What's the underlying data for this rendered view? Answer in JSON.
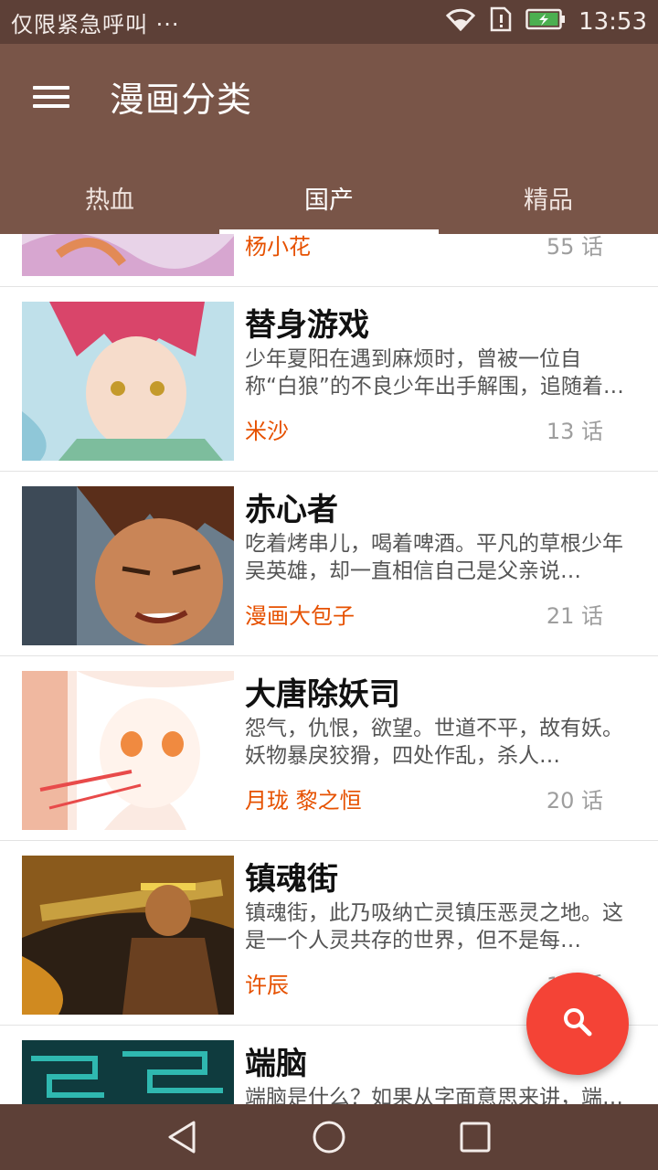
{
  "status_bar": {
    "carrier": "仅限紧急呼叫 ···",
    "time": "13:53"
  },
  "app_bar": {
    "title": "漫画分类",
    "tabs": [
      {
        "label": "热血",
        "active": false
      },
      {
        "label": "国产",
        "active": true
      },
      {
        "label": "精品",
        "active": false
      }
    ]
  },
  "comics": [
    {
      "title": "",
      "description": "",
      "author": "杨小花",
      "chapters": "55 话"
    },
    {
      "title": "替身游戏",
      "description": "少年夏阳在遇到麻烦时，曾被一位自称“白狼”的不良少年出手解围，追随着…",
      "author": "米沙",
      "chapters": "13 话"
    },
    {
      "title": "赤心者",
      "description": "吃着烤串儿，喝着啤酒。平凡的草根少年吴英雄，却一直相信自己是父亲说…",
      "author": "漫画大包子",
      "chapters": "21 话"
    },
    {
      "title": "大唐除妖司",
      "description": "怨气，仇恨，欲望。世道不平，故有妖。妖物暴戾狡猾，四处作乱，杀人…",
      "author": "月珑 黎之恒",
      "chapters": "20 话"
    },
    {
      "title": "镇魂街",
      "description": "镇魂街，此乃吸纳亡灵镇压恶灵之地。这是一个人灵共存的世界，但不是每…",
      "author": "许辰",
      "chapters": "19 话"
    },
    {
      "title": "端脑",
      "description": "端脑是什么？如果从字面意思来讲，端…",
      "author": "",
      "chapters": ""
    }
  ],
  "colors": {
    "status_bar": "#5d4037",
    "app_bar": "#795548",
    "accent_fab": "#f44336",
    "author": "#e65100"
  },
  "icons": {
    "menu": "hamburger-menu-icon",
    "search": "search-icon",
    "back": "triangle-back-icon",
    "home": "circle-home-icon",
    "recents": "square-recents-icon"
  }
}
